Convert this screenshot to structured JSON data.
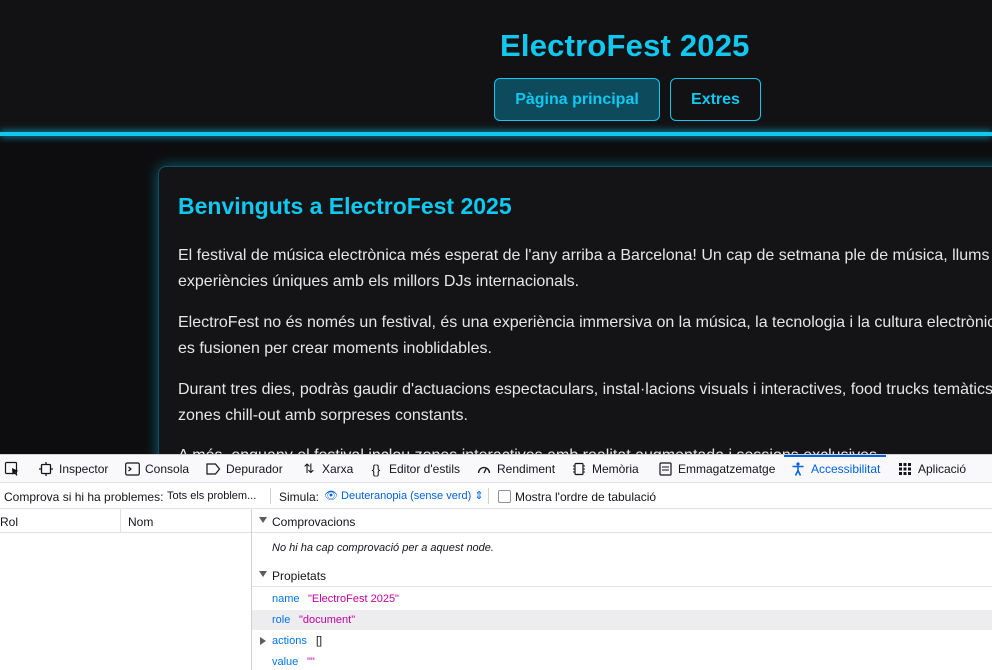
{
  "site": {
    "title": "ElectroFest 2025",
    "nav": {
      "home": "Pàgina principal",
      "extras": "Extres"
    },
    "card": {
      "heading": "Benvinguts a ElectroFest 2025",
      "paragraphs": [
        "El festival de música electrònica més esperat de l'any arriba a Barcelona! Un cap de setmana ple de música, llums i experiències úniques amb els millors DJs internacionals.",
        "ElectroFest no és només un festival, és una experiència immersiva on la música, la tecnologia i la cultura electrònica es fusionen per crear moments inoblidables.",
        "Durant tres dies, podràs gaudir d'actuacions espectaculars, instal·lacions visuals i interactives, food trucks temàtics i zones chill-out amb sorpreses constants.",
        "A més, enguany el festival inclou zones interactives amb realitat augmentada i sessions exclusives."
      ]
    },
    "colors": {
      "accent": "#10c8f0",
      "background": "#0d0d0f"
    }
  },
  "devtools": {
    "tabs": [
      {
        "label": "Inspector",
        "icon": "inspector-icon"
      },
      {
        "label": "Consola",
        "icon": "console-icon"
      },
      {
        "label": "Depurador",
        "icon": "debugger-icon"
      },
      {
        "label": "Xarxa",
        "icon": "network-icon"
      },
      {
        "label": "Editor d'estils",
        "icon": "style-editor-icon"
      },
      {
        "label": "Rendiment",
        "icon": "performance-icon"
      },
      {
        "label": "Memòria",
        "icon": "memory-icon"
      },
      {
        "label": "Emmagatzematge",
        "icon": "storage-icon"
      },
      {
        "label": "Accessibilitat",
        "icon": "accessibility-icon"
      },
      {
        "label": "Aplicació",
        "icon": "application-icon"
      }
    ],
    "active_tab": "Accessibilitat",
    "toolbar": {
      "check_label": "Comprova si hi ha problemes:",
      "check_value": "Tots els problem...",
      "simulate_label": "Simula:",
      "simulate_value": "Deuteranopia (sense verd)",
      "tab_order_label": "Mostra l'ordre de tabulació"
    },
    "tree": {
      "col_role": "Rol",
      "col_name": "Nom"
    },
    "checks": {
      "title": "Comprovacions",
      "empty": "No hi ha cap comprovació per a aquest node."
    },
    "properties": {
      "title": "Propietats",
      "items": [
        {
          "key": "name",
          "value": "\"ElectroFest 2025\""
        },
        {
          "key": "role",
          "value": "\"document\""
        },
        {
          "key": "actions",
          "value": "[]"
        },
        {
          "key": "value",
          "value": "\"\""
        }
      ]
    }
  }
}
